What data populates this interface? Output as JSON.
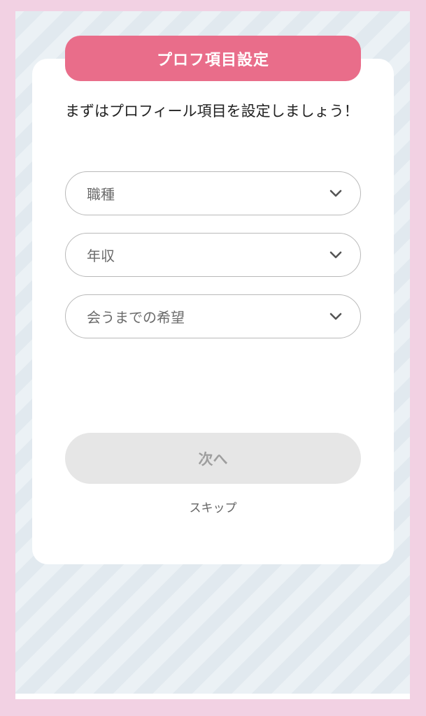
{
  "header": {
    "title": "プロフ項目設定"
  },
  "intro": {
    "text": "まずはプロフィール項目を設定しましょう！"
  },
  "fields": [
    {
      "label": "職種"
    },
    {
      "label": "年収"
    },
    {
      "label": "会うまでの希望"
    }
  ],
  "actions": {
    "next_label": "次へ",
    "skip_label": "スキップ"
  },
  "colors": {
    "accent": "#e96d8a",
    "frame": "#f2d1e3",
    "disabled_button": "#e6e6e6"
  },
  "icons": {
    "dropdown": "chevron-down-icon"
  }
}
